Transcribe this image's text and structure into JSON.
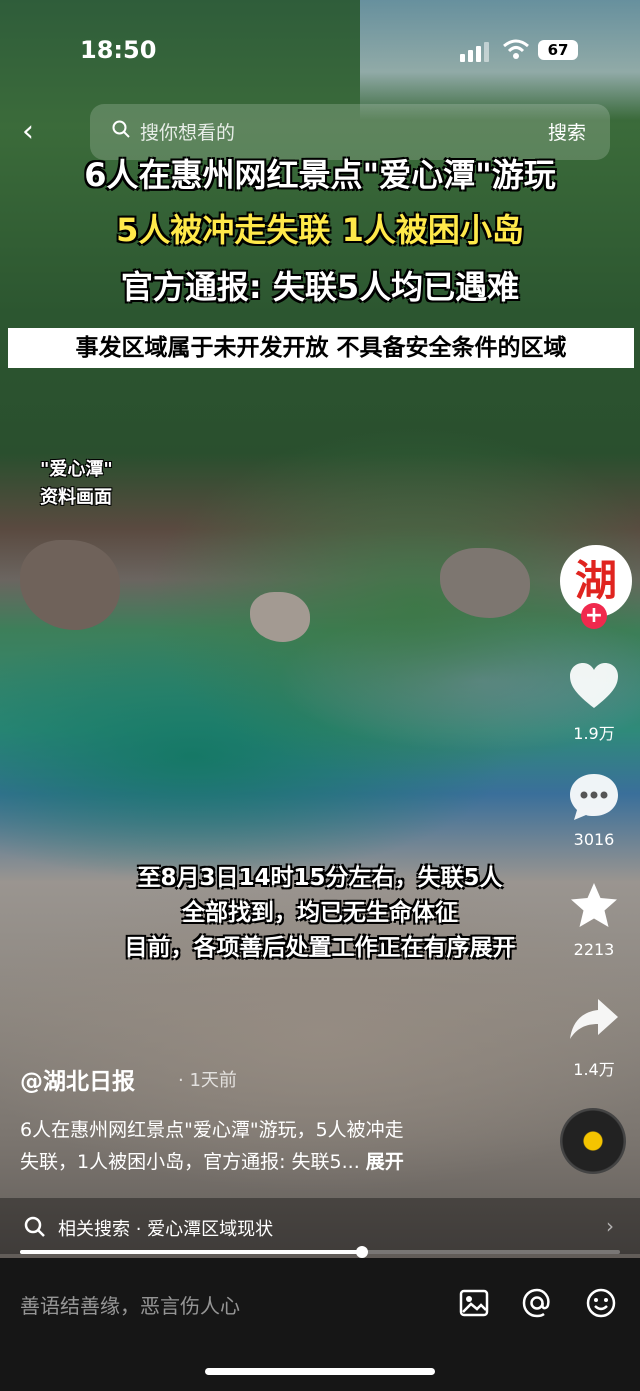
{
  "status": {
    "time": "18:50",
    "battery": "67"
  },
  "search": {
    "placeholder": "搜你想看的",
    "button": "搜索"
  },
  "headline": {
    "line1": "6人在惠州网红景点\"爱心潭\"游玩",
    "line2": "5人被冲走失联 1人被困小岛",
    "line3": "官方通报: 失联5人均已遇难",
    "subbar": "事发区域属于未开发开放 不具备安全条件的区域"
  },
  "tag": {
    "line1": "\"爱心潭\"",
    "line2": "资料画面"
  },
  "caption": {
    "line1": "至8月3日14时15分左右，失联5人",
    "line2": "全部找到，均已无生命体征",
    "line3": "目前，各项善后处置工作正在有序展开"
  },
  "creator": {
    "avatar_text": "湖",
    "follow": "+"
  },
  "actions": {
    "likes": "1.9万",
    "comments": "3016",
    "favorites": "2213",
    "shares": "1.4万"
  },
  "post": {
    "author": "@湖北日报",
    "time_ago": "· 1天前",
    "desc1": "6人在惠州网红景点\"爱心潭\"游玩，5人被冲走",
    "desc2": "失联，1人被困小岛，官方通报: 失联5...",
    "expand": "展开"
  },
  "related": {
    "text": "相关搜索 · 爱心潭区域现状",
    "arrow": "›"
  },
  "progress": {
    "value": 0.57
  },
  "bottom": {
    "comment_placeholder": "善语结善缘，恶言伤人心"
  },
  "icons": [
    "back-icon",
    "search-icon",
    "heart-icon",
    "comment-icon",
    "star-icon",
    "share-icon",
    "image-icon",
    "at-icon",
    "emoji-icon"
  ]
}
